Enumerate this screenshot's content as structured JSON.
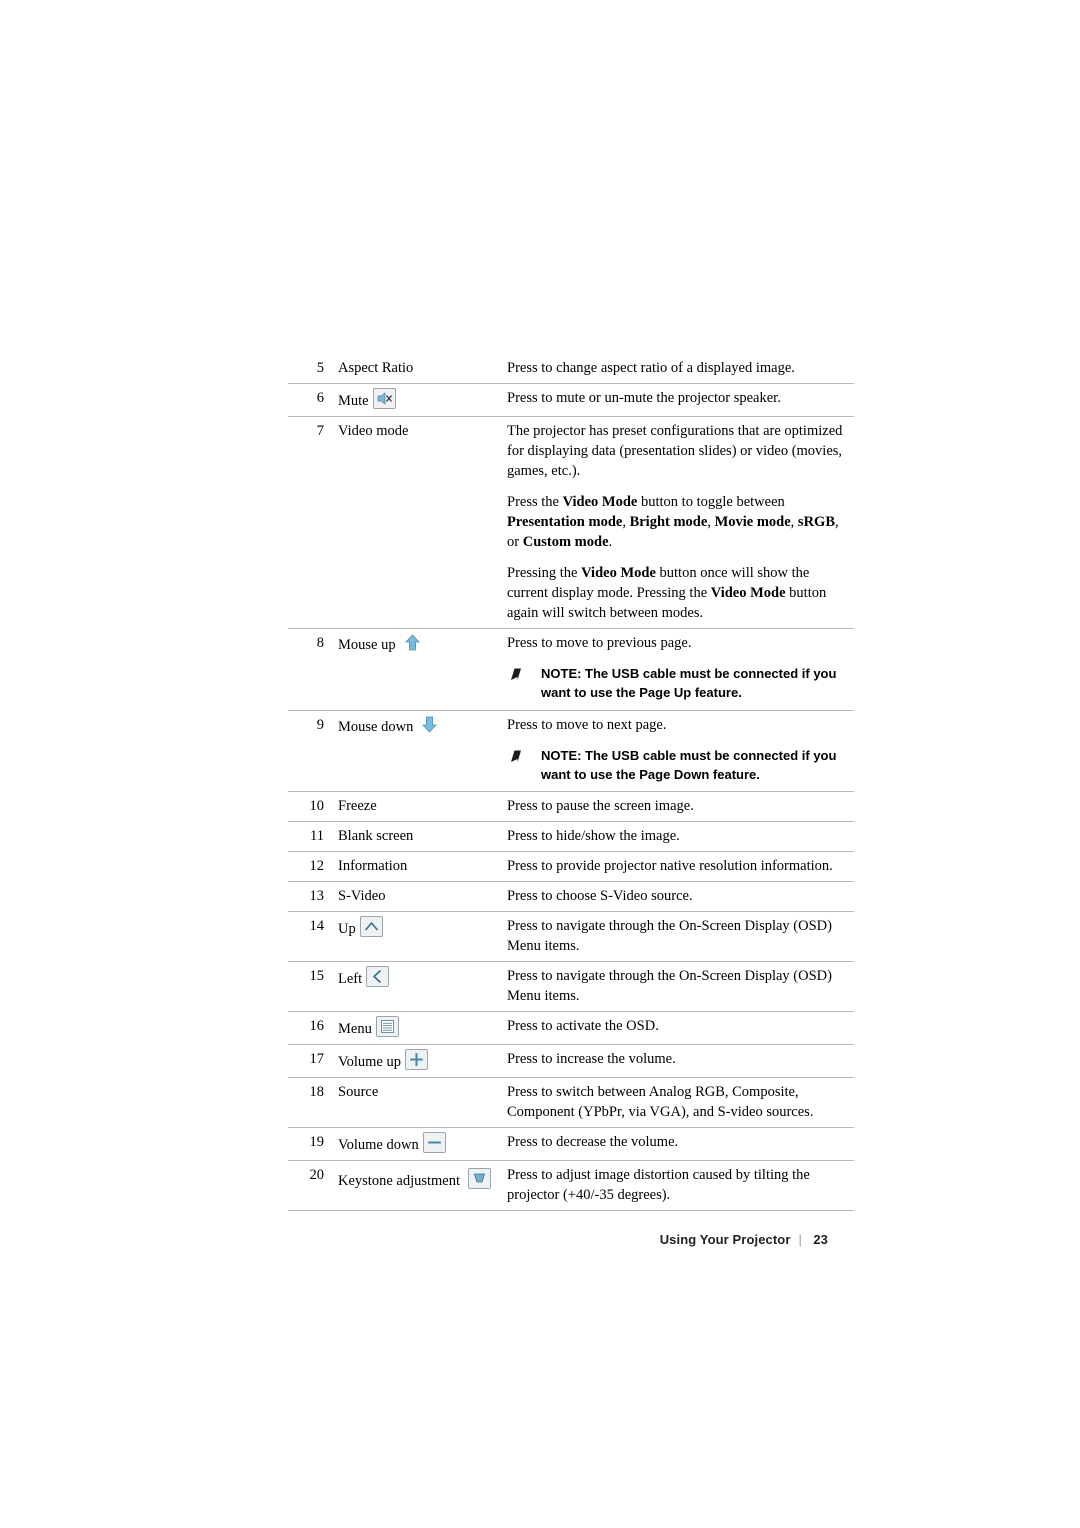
{
  "document": {
    "footer": {
      "section": "Using Your Projector",
      "separator": "|",
      "page_number": "23"
    }
  },
  "table": {
    "rows": [
      {
        "num": "5",
        "name": "Aspect Ratio",
        "icon": "",
        "desc": [
          "Press to change aspect ratio of a displayed image."
        ]
      },
      {
        "num": "6",
        "name": "Mute",
        "icon": "mute-icon",
        "desc": [
          "Press to mute or un-mute the projector speaker."
        ]
      },
      {
        "num": "7",
        "name": "Video mode",
        "icon": "",
        "desc": [
          "The projector has preset configurations that are optimized for displaying data (presentation slides) or video (movies, games, etc.).",
          "Press the <b>Video Mode</b> button to toggle between <b>Presentation mode</b>, <b>Bright mode</b>, <b>Movie mode</b>, <b>sRGB</b>, or <b>Custom mode</b>.",
          "Pressing the <b>Video Mode</b> button once will show the current display mode. Pressing the <b>Video Mode</b> button again will switch between modes."
        ]
      },
      {
        "num": "8",
        "name": "Mouse up",
        "icon": "arrow-up-icon",
        "desc": [
          "Press to move to previous page."
        ],
        "note": "NOTE: The USB cable must be connected if you want to use the Page Up feature."
      },
      {
        "num": "9",
        "name": "Mouse down",
        "icon": "arrow-down-icon",
        "desc": [
          "Press to move to next page."
        ],
        "note": "NOTE: The USB cable must be connected if you want to use the Page Down feature."
      },
      {
        "num": "10",
        "name": "Freeze",
        "icon": "",
        "desc": [
          "Press to pause the screen image."
        ]
      },
      {
        "num": "11",
        "name": "Blank screen",
        "icon": "",
        "desc": [
          "Press to hide/show the image."
        ]
      },
      {
        "num": "12",
        "name": "Information",
        "icon": "",
        "desc": [
          "Press to provide projector native resolution information."
        ]
      },
      {
        "num": "13",
        "name": "S-Video",
        "icon": "",
        "desc": [
          "Press to choose S-Video source."
        ]
      },
      {
        "num": "14",
        "name": "Up",
        "icon": "up-caret-icon",
        "desc": [
          "Press to navigate through the On-Screen Display (OSD) Menu items."
        ]
      },
      {
        "num": "15",
        "name": "Left",
        "icon": "left-caret-icon",
        "desc": [
          "Press to navigate through the On-Screen Display (OSD) Menu items."
        ]
      },
      {
        "num": "16",
        "name": "Menu",
        "icon": "menu-icon",
        "desc": [
          "Press to activate the OSD."
        ]
      },
      {
        "num": "17",
        "name": "Volume up",
        "icon": "plus-icon",
        "desc": [
          "Press to increase the volume."
        ]
      },
      {
        "num": "18",
        "name": "Source",
        "icon": "",
        "desc": [
          "Press to switch between Analog RGB, Composite, Component (YPbPr, via VGA), and S-video sources."
        ]
      },
      {
        "num": "19",
        "name": "Volume down",
        "icon": "minus-icon",
        "desc": [
          "Press to decrease the volume."
        ]
      },
      {
        "num": "20",
        "name": "Keystone adjustment",
        "icon": "keystone-icon",
        "desc": [
          "Press to adjust image distortion caused by tilting the projector (+40/-35 degrees)."
        ]
      }
    ]
  },
  "colors": {
    "rule": "#b9b9b9",
    "icon_border": "#9aa4ab",
    "icon_fill": "#eef2f5",
    "arrow_blue": "#6fb5d8",
    "text": "#000000"
  }
}
